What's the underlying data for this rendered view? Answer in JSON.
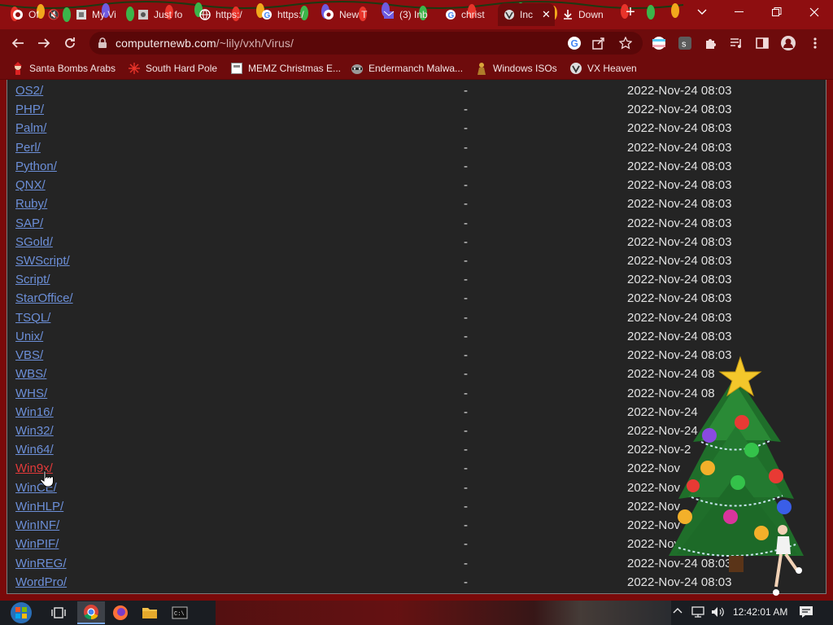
{
  "tabs": [
    {
      "title": "Of",
      "favicon": "mute-tab-icon"
    },
    {
      "title": "My Vi",
      "favicon": "site-icon"
    },
    {
      "title": "Just fo",
      "favicon": "site-icon"
    },
    {
      "title": "https:/",
      "favicon": "web-icon"
    },
    {
      "title": "https:/",
      "favicon": "google-icon"
    },
    {
      "title": "New T",
      "favicon": "chrome-icon"
    },
    {
      "title": "(3) Inb",
      "favicon": "mail-icon"
    },
    {
      "title": "christ",
      "favicon": "google-icon"
    },
    {
      "title": "Inc",
      "favicon": "vx-heaven-icon",
      "active": true
    },
    {
      "title": "Down",
      "favicon": "download-icon"
    }
  ],
  "address_bar": {
    "url_host": "computernewb.com",
    "url_path": "/~lily/vxh/Virus/"
  },
  "bookmarks": [
    {
      "label": "Santa Bombs Arabs",
      "icon": "santa-icon"
    },
    {
      "label": "South Hard Pole",
      "icon": "snowflake-icon"
    },
    {
      "label": "MEMZ Christmas E...",
      "icon": "memz-icon"
    },
    {
      "label": "Endermanch Malwa...",
      "icon": "raccoon-icon"
    },
    {
      "label": "Windows ISOs",
      "icon": "windows-isos-icon"
    },
    {
      "label": "VX Heaven",
      "icon": "vx-heaven-icon"
    }
  ],
  "listing": {
    "rows": [
      {
        "name": "OS2/",
        "size": "-",
        "date": "2022-Nov-24 08:03"
      },
      {
        "name": "PHP/",
        "size": "-",
        "date": "2022-Nov-24 08:03"
      },
      {
        "name": "Palm/",
        "size": "-",
        "date": "2022-Nov-24 08:03"
      },
      {
        "name": "Perl/",
        "size": "-",
        "date": "2022-Nov-24 08:03"
      },
      {
        "name": "Python/",
        "size": "-",
        "date": "2022-Nov-24 08:03"
      },
      {
        "name": "QNX/",
        "size": "-",
        "date": "2022-Nov-24 08:03"
      },
      {
        "name": "Ruby/",
        "size": "-",
        "date": "2022-Nov-24 08:03"
      },
      {
        "name": "SAP/",
        "size": "-",
        "date": "2022-Nov-24 08:03"
      },
      {
        "name": "SGold/",
        "size": "-",
        "date": "2022-Nov-24 08:03"
      },
      {
        "name": "SWScript/",
        "size": "-",
        "date": "2022-Nov-24 08:03"
      },
      {
        "name": "Script/",
        "size": "-",
        "date": "2022-Nov-24 08:03"
      },
      {
        "name": "StarOffice/",
        "size": "-",
        "date": "2022-Nov-24 08:03"
      },
      {
        "name": "TSQL/",
        "size": "-",
        "date": "2022-Nov-24 08:03"
      },
      {
        "name": "Unix/",
        "size": "-",
        "date": "2022-Nov-24 08:03"
      },
      {
        "name": "VBS/",
        "size": "-",
        "date": "2022-Nov-24 08:03"
      },
      {
        "name": "WBS/",
        "size": "-",
        "date": "2022-Nov-24 08"
      },
      {
        "name": "WHS/",
        "size": "-",
        "date": "2022-Nov-24 08"
      },
      {
        "name": "Win16/",
        "size": "-",
        "date": "2022-Nov-24"
      },
      {
        "name": "Win32/",
        "size": "-",
        "date": "2022-Nov-24"
      },
      {
        "name": "Win64/",
        "size": "-",
        "date": "2022-Nov-2"
      },
      {
        "name": "Win9x/",
        "size": "-",
        "date": "2022-Nov",
        "hover": true
      },
      {
        "name": "WinCE/",
        "size": "-",
        "date": "2022-Nov"
      },
      {
        "name": "WinHLP/",
        "size": "-",
        "date": "2022-Nov"
      },
      {
        "name": "WinINF/",
        "size": "-",
        "date": "2022-Nov"
      },
      {
        "name": "WinPIF/",
        "size": "-",
        "date": "2022-Nov-24 08:0"
      },
      {
        "name": "WinREG/",
        "size": "-",
        "date": "2022-Nov-24 08:03"
      },
      {
        "name": "WordPro/",
        "size": "-",
        "date": "2022-Nov-24 08:03"
      }
    ]
  },
  "taskbar": {
    "apps": [
      {
        "name": "task-view",
        "icon": "task-view-icon"
      },
      {
        "name": "chrome",
        "icon": "chrome-icon",
        "active": true
      },
      {
        "name": "firefox",
        "icon": "firefox-icon"
      },
      {
        "name": "file-explorer",
        "icon": "folder-icon"
      },
      {
        "name": "command-prompt",
        "icon": "cmd-icon"
      }
    ],
    "clock": "12:42:01 AM"
  },
  "colors": {
    "chrome_frame": "#8e0e10",
    "toolbar": "#6e0b0c",
    "page_bg": "#242424",
    "link": "#6c8fd8",
    "link_hover": "#e23a3a",
    "text": "#e2e2e2"
  }
}
